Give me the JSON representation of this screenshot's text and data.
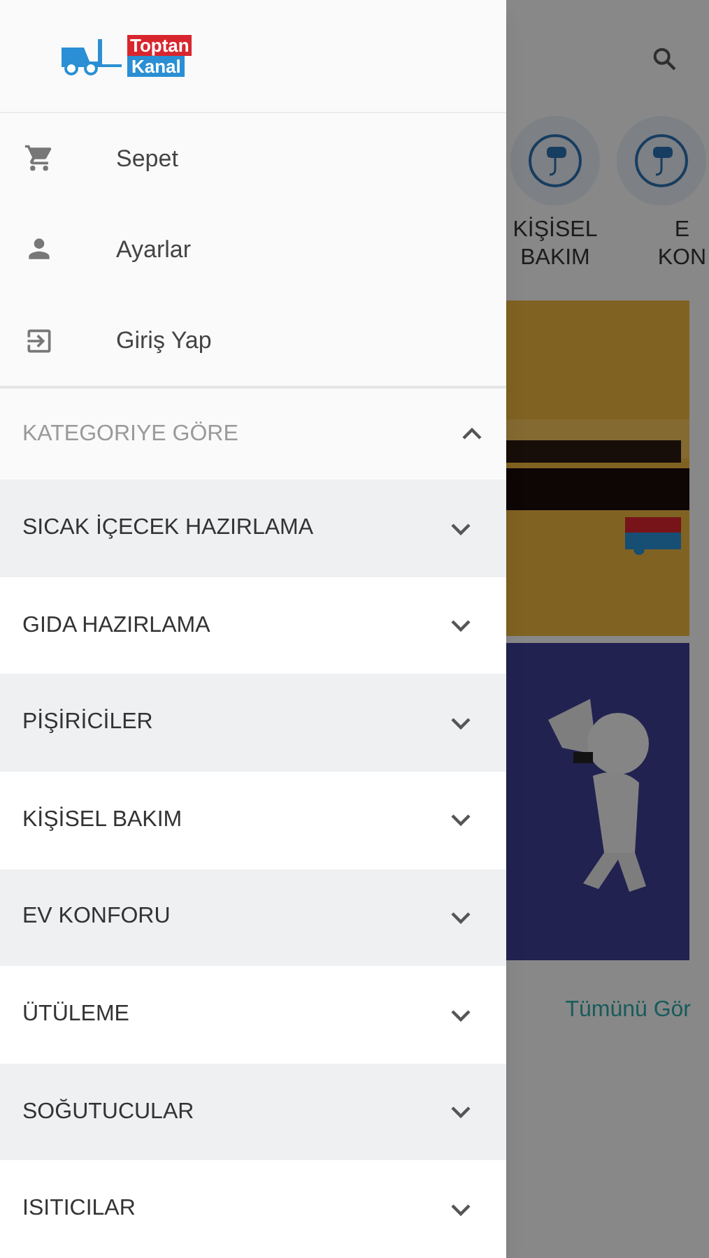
{
  "drawer": {
    "logo": {
      "top": "Toptan",
      "bottom": "Kanal"
    },
    "menu": [
      {
        "kind": "cart",
        "label": "Sepet"
      },
      {
        "kind": "person",
        "label": "Ayarlar"
      },
      {
        "kind": "login",
        "label": "Giriş Yap"
      }
    ],
    "section": {
      "title": "KATEGORIYE GÖRE",
      "expanded": true
    },
    "categories": [
      {
        "label": "SICAK İÇECEK HAZIRLAMA",
        "expanded": false
      },
      {
        "label": "GIDA HAZIRLAMA",
        "expanded": false
      },
      {
        "label": "PİŞİRİCİLER",
        "expanded": false
      },
      {
        "label": "KİŞİSEL BAKIM",
        "expanded": false
      },
      {
        "label": "EV KONFORU",
        "expanded": false
      },
      {
        "label": "ÜTÜLEME",
        "expanded": false
      },
      {
        "label": "SOĞUTUCULAR",
        "expanded": false
      },
      {
        "label": "ISITICILAR",
        "expanded": false
      }
    ]
  },
  "background": {
    "categories": [
      {
        "lines": [
          "KİŞİSEL",
          "BAKIM"
        ]
      },
      {
        "lines": [
          "E",
          "KON"
        ]
      }
    ],
    "see_all": "Tümünü Gör"
  }
}
